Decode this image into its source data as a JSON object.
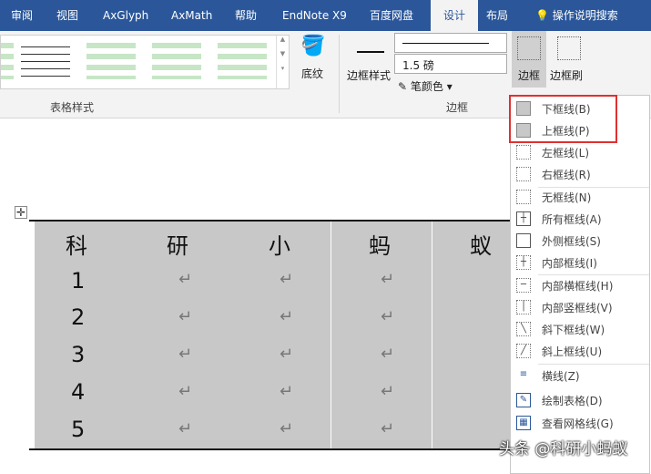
{
  "tabs": [
    "审阅",
    "视图",
    "AxGlyph",
    "AxMath",
    "帮助",
    "EndNote X9",
    "百度网盘",
    "设计",
    "布局"
  ],
  "search": "操作说明搜索",
  "ribbon": {
    "shading": "底纹",
    "table_styles_group": "表格样式",
    "border_styles": "边框样式",
    "line_weight": "1.5 磅",
    "pen_color": "笔颜色",
    "borders": "边框",
    "border_painter": "边框刷",
    "borders_group": "边框"
  },
  "menu": [
    {
      "label": "下框线(B)",
      "selected": true
    },
    {
      "label": "上框线(P)",
      "selected": true
    },
    {
      "label": "左框线(L)"
    },
    {
      "label": "右框线(R)"
    },
    {
      "label": "无框线(N)"
    },
    {
      "label": "所有框线(A)"
    },
    {
      "label": "外侧框线(S)"
    },
    {
      "label": "内部框线(I)"
    },
    {
      "label": "内部横框线(H)"
    },
    {
      "label": "内部竖框线(V)"
    },
    {
      "label": "斜下框线(W)"
    },
    {
      "label": "斜上框线(U)"
    },
    {
      "label": "横线(Z)"
    },
    {
      "label": "绘制表格(D)"
    },
    {
      "label": "查看网格线(G)"
    }
  ],
  "table": {
    "header": [
      "科",
      "研",
      "小",
      "蚂",
      "蚁"
    ],
    "rows": [
      "1",
      "2",
      "3",
      "4",
      "5"
    ]
  },
  "watermark": "头条 @科研小蚂蚁"
}
